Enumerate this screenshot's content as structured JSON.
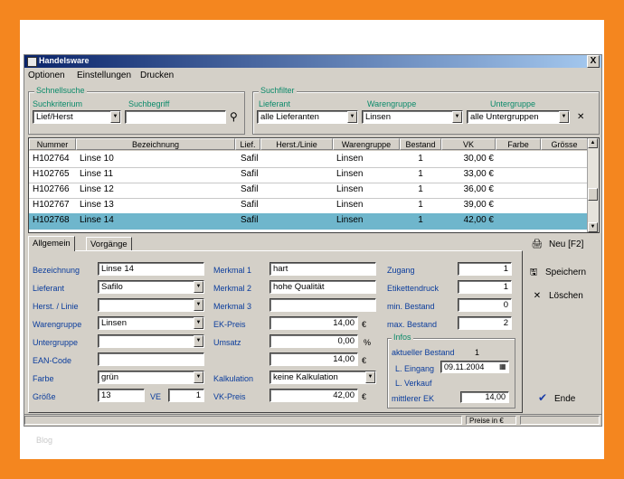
{
  "window": {
    "title": "Handelsware",
    "close": "X"
  },
  "menu": [
    "Optionen",
    "Einstellungen",
    "Drucken"
  ],
  "search_group": {
    "legend": "Schnellsuche",
    "field_label": "Suchkriterium",
    "term_label": "Suchbegriff",
    "field_value": "Lief/Herst",
    "term_value": ""
  },
  "filter_group": {
    "legend": "Suchfilter",
    "supplier_label": "Lieferant",
    "group_label": "Warengruppe",
    "subgroup_label": "Untergruppe",
    "supplier_value": "alle Lieferanten",
    "group_value": "Linsen",
    "subgroup_value": "alle Untergruppen"
  },
  "table": {
    "columns": [
      "Nummer",
      "Bezeichnung",
      "Lief.",
      "Herst./Linie",
      "Warengruppe",
      "Bestand",
      "VK",
      "Farbe",
      "Grösse"
    ],
    "rows": [
      [
        "H102764",
        "Linse 10",
        "Safil",
        "",
        "Linsen",
        "1",
        "30,00 €",
        "",
        ""
      ],
      [
        "H102765",
        "Linse 11",
        "Safil",
        "",
        "Linsen",
        "1",
        "33,00 €",
        "",
        ""
      ],
      [
        "H102766",
        "Linse 12",
        "Safil",
        "",
        "Linsen",
        "1",
        "36,00 €",
        "",
        ""
      ],
      [
        "H102767",
        "Linse 13",
        "Safil",
        "",
        "Linsen",
        "1",
        "39,00 €",
        "",
        ""
      ],
      [
        "H102768",
        "Linse 14",
        "Safil",
        "",
        "Linsen",
        "1",
        "42,00 €",
        "",
        ""
      ]
    ],
    "selected_row": 4
  },
  "tabs": [
    "Allgemein",
    "Vorgänge"
  ],
  "form": {
    "labels": {
      "bezeichnung": "Bezeichnung",
      "lieferant": "Lieferant",
      "herst": "Herst. / Linie",
      "warengruppe": "Warengruppe",
      "untergruppe": "Untergruppe",
      "ean": "EAN-Code",
      "farbe": "Farbe",
      "groesse": "Größe",
      "ve": "VE",
      "merkmal1": "Merkmal 1",
      "merkmal2": "Merkmal 2",
      "merkmal3": "Merkmal 3",
      "ek": "EK-Preis",
      "kalkulation": "Kalkulation",
      "aufschlag": "Umsatz",
      "vk": "VK-Preis",
      "zugang": "Zugang",
      "etiketten": "Etikettendruck",
      "min": "min. Bestand",
      "max": "max. Bestand"
    },
    "values": {
      "bezeichnung": "Linse 14",
      "lieferant": "Safilo",
      "herst": "",
      "warengruppe": "Linsen",
      "untergruppe": "",
      "ean": "",
      "farbe": "grün",
      "groesse": "13",
      "ve": "1",
      "merkmal1": "hart",
      "merkmal2": "hohe Qualität",
      "merkmal3": "",
      "ek": "14,00",
      "ek_unit": "€",
      "aufschlag": "0,00",
      "aufschlag_unit": "%",
      "ek_calc": "14,00",
      "ek_calc_unit": "€",
      "kalkulation": "keine Kalkulation",
      "vk": "42,00",
      "vk_unit": "€",
      "zugang": "1",
      "etiketten": "1",
      "min": "0",
      "max": "2"
    },
    "info": {
      "legend": "Infos",
      "bestand_label": "aktueller Bestand",
      "bestand_value": "1",
      "eingang_label": "L. Eingang",
      "eingang_value": "09.11.2004",
      "verkauf_label": "L. Verkauf",
      "ek_label": "mittlerer EK",
      "ek_value": "14,00"
    }
  },
  "side_buttons": {
    "new": "Neu [F2]",
    "save": "Speichern",
    "delete": "Löschen",
    "end": "Ende"
  },
  "status": {
    "price": "Preise in €"
  },
  "footer": "Blog"
}
